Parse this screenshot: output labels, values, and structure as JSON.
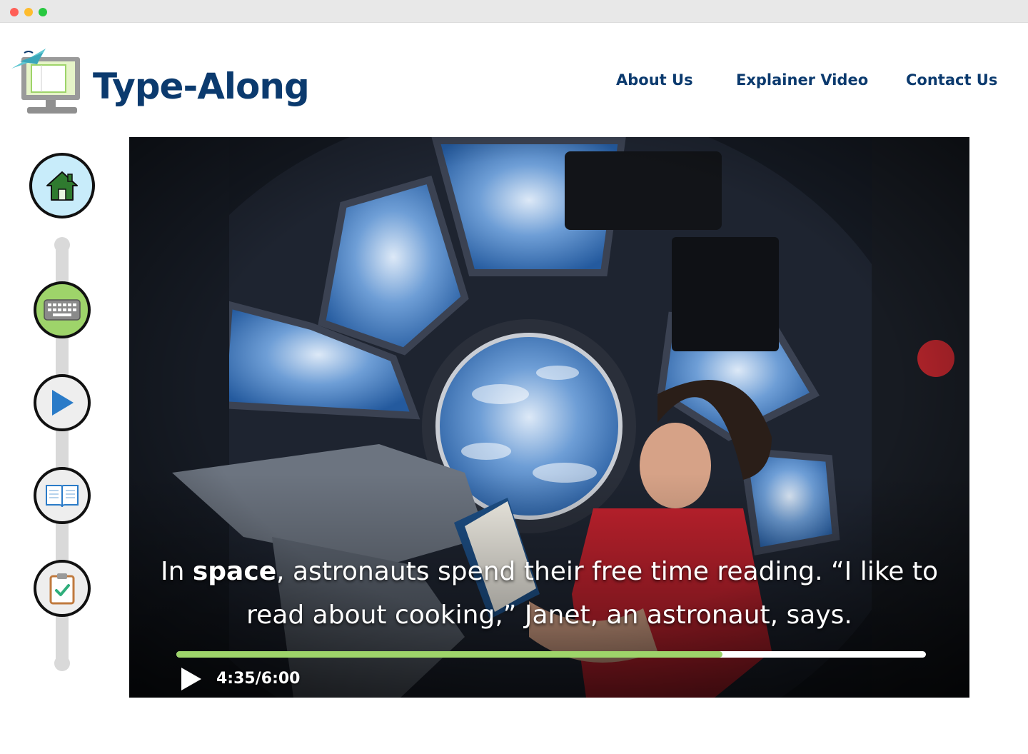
{
  "app": {
    "brand_name": "Type-Along"
  },
  "nav": {
    "items": [
      {
        "label": "About Us"
      },
      {
        "label": "Explainer Video"
      },
      {
        "label": "Contact Us"
      }
    ]
  },
  "steps": [
    {
      "icon": "home-icon",
      "fill": "#c8ecfa",
      "state": "active"
    },
    {
      "icon": "keyboard-icon",
      "fill": "#9ed46a",
      "state": "completed"
    },
    {
      "icon": "play-icon",
      "fill": "#eeeeee",
      "state": "default"
    },
    {
      "icon": "book-icon",
      "fill": "#eeeeee",
      "state": "default"
    },
    {
      "icon": "clipboard-check-icon",
      "fill": "#eeeeee",
      "state": "default"
    }
  ],
  "video": {
    "caption_pre": "In ",
    "caption_bold": "space",
    "caption_post": ", astronauts spend their free time reading. “I like to read about cooking,” Janet, an astronaut, says.",
    "time": "4:35/6:00",
    "progress": 0.729
  },
  "colors": {
    "brand": "#0b3a6e",
    "progress_fill": "#9ed46a",
    "progress_track": "#ffffff",
    "rail": "#d9d9d9"
  }
}
